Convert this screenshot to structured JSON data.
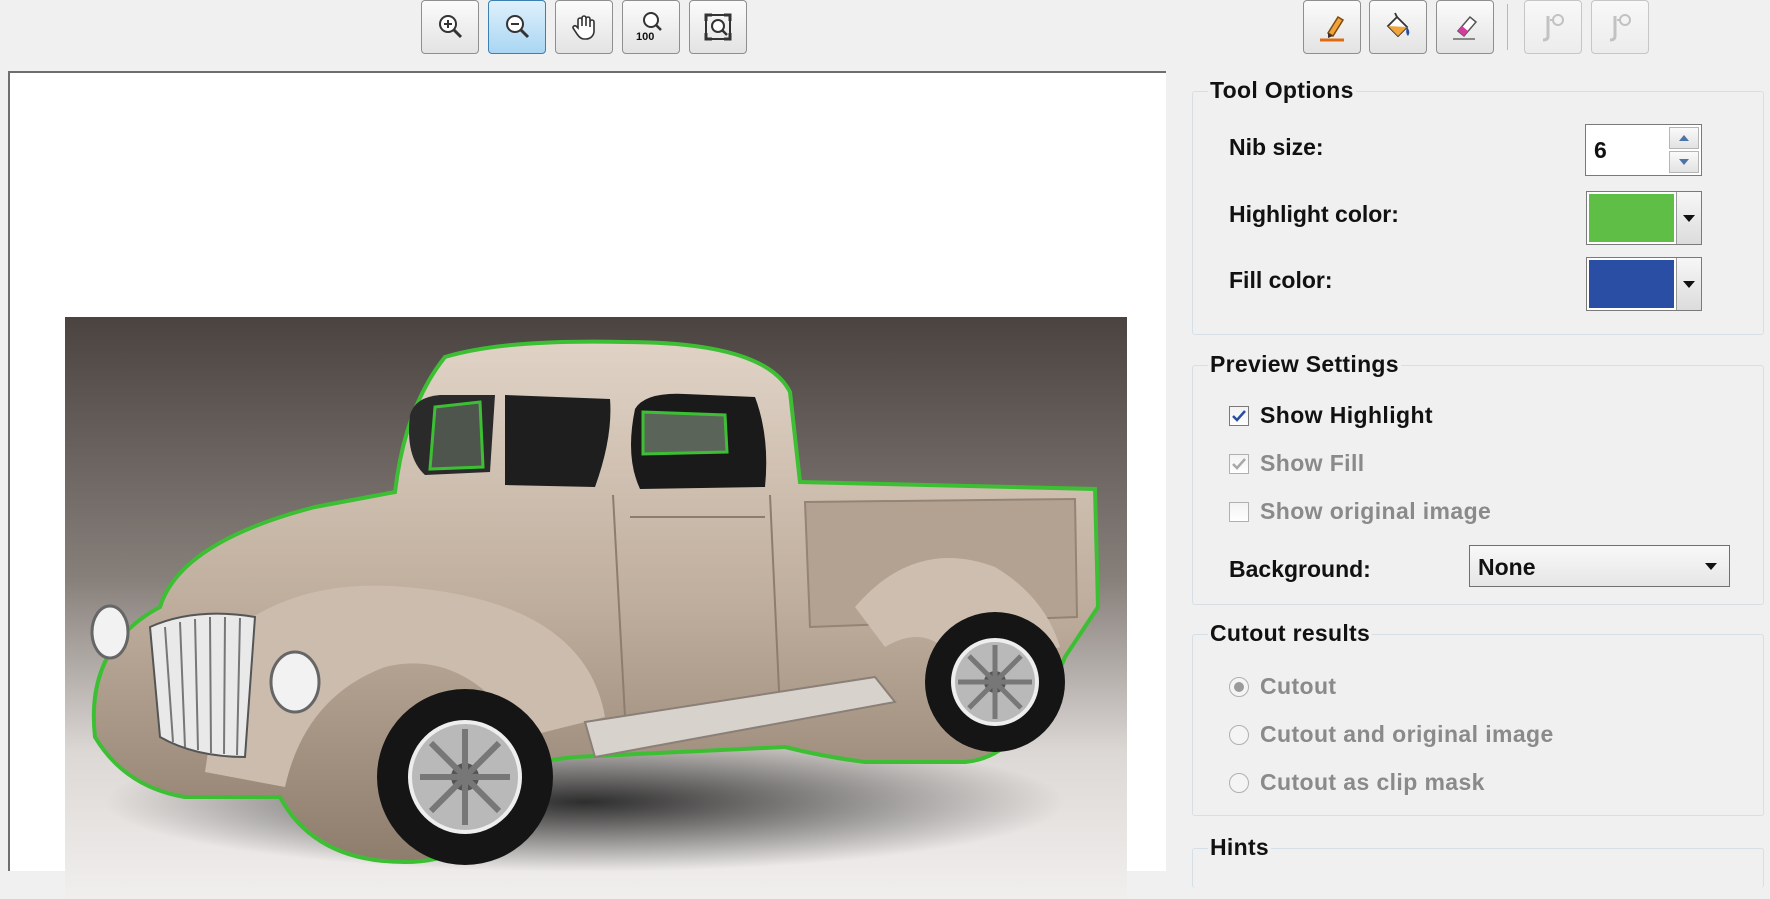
{
  "toolbar": {
    "left": [
      {
        "name": "zoom-in",
        "icon": "zoom-in-icon",
        "active": false
      },
      {
        "name": "zoom-out",
        "icon": "zoom-out-icon",
        "active": true
      },
      {
        "name": "pan",
        "icon": "hand-icon",
        "active": false
      },
      {
        "name": "zoom-100",
        "icon": "zoom-100-icon",
        "label": "100",
        "active": false
      },
      {
        "name": "fit-window",
        "icon": "fit-window-icon",
        "active": false
      }
    ],
    "right": [
      {
        "name": "highlighter",
        "icon": "highlighter-icon"
      },
      {
        "name": "fill",
        "icon": "paint-bucket-icon"
      },
      {
        "name": "eraser",
        "icon": "eraser-icon"
      },
      {
        "name": "undo",
        "icon": "undo-icon",
        "disabled": true
      },
      {
        "name": "redo",
        "icon": "redo-icon",
        "disabled": true
      }
    ]
  },
  "tool_options": {
    "title": "Tool Options",
    "nib_label": "Nib size:",
    "nib_value": "6",
    "highlight_label": "Highlight color:",
    "highlight_color": "#5fbe45",
    "fill_label": "Fill color:",
    "fill_color": "#2a4ea3"
  },
  "preview_settings": {
    "title": "Preview Settings",
    "show_highlight": {
      "label": "Show Highlight",
      "checked": true
    },
    "show_fill": {
      "label": "Show Fill",
      "checked": true,
      "disabled": true
    },
    "show_original": {
      "label": "Show original image",
      "checked": false,
      "disabled": true
    },
    "background_label": "Background:",
    "background_value": "None"
  },
  "cutout_results": {
    "title": "Cutout results",
    "options": [
      {
        "label": "Cutout",
        "selected": true
      },
      {
        "label": "Cutout and original image",
        "selected": false
      },
      {
        "label": "Cutout as clip mask",
        "selected": false
      }
    ]
  },
  "hints": {
    "title": "Hints"
  },
  "colors": {
    "accent": "#3c7fb1",
    "highlight_outline": "#3dbf34"
  }
}
